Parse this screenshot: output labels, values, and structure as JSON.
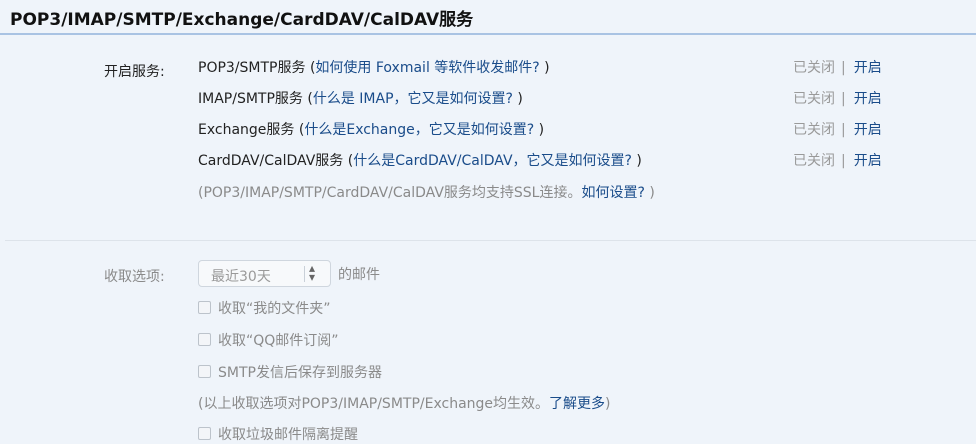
{
  "title": "POP3/IMAP/SMTP/Exchange/CardDAV/CalDAV服务",
  "services_label": "开启服务:",
  "services": [
    {
      "name": "POP3/SMTP服务",
      "help_open": " (",
      "help_link": "如何使用 Foxmail 等软件收发邮件?",
      "help_close": " )",
      "status_off": "已关闭",
      "sep": "|",
      "action": "开启"
    },
    {
      "name": "IMAP/SMTP服务",
      "help_open": " (",
      "help_link": "什么是 IMAP，它又是如何设置?",
      "help_close": " )",
      "status_off": "已关闭",
      "sep": "|",
      "action": "开启"
    },
    {
      "name": "Exchange服务",
      "help_open": " (",
      "help_link": "什么是Exchange，它又是如何设置?",
      "help_close": " )",
      "status_off": "已关闭",
      "sep": "|",
      "action": "开启"
    },
    {
      "name": "CardDAV/CalDAV服务",
      "help_open": " (",
      "help_link": "什么是CardDAV/CalDAV，它又是如何设置?",
      "help_close": " )",
      "status_off": "已关闭",
      "sep": "|",
      "action": "开启"
    }
  ],
  "ssl_note": {
    "text": "(POP3/IMAP/SMTP/CardDAV/CalDAV服务均支持SSL连接。",
    "link": "如何设置?",
    "close": " )"
  },
  "fetch": {
    "label": "收取选项:",
    "select_value": "最近30天",
    "select_suffix": "的邮件",
    "options": [
      {
        "label": "收取“我的文件夹”"
      },
      {
        "label": "收取“QQ邮件订阅”"
      },
      {
        "label": "SMTP发信后保存到服务器"
      }
    ],
    "note": {
      "text": "(以上收取选项对POP3/IMAP/SMTP/Exchange均生效。",
      "link": "了解更多",
      "close": ")"
    },
    "junk_option": {
      "label": "收取垃圾邮件隔离提醒"
    }
  }
}
